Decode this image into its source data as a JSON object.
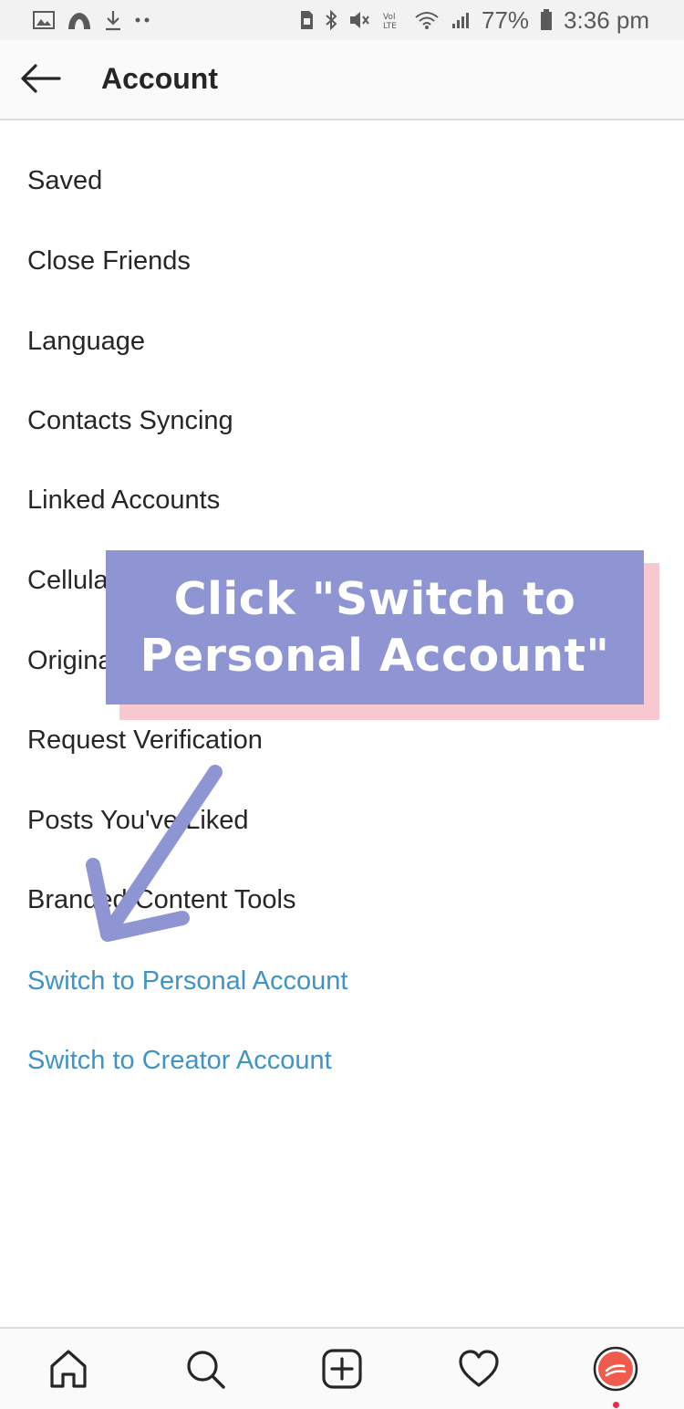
{
  "status_bar": {
    "battery": "77%",
    "time": "3:36 pm",
    "icons_left": [
      "image-icon",
      "cloud-icon",
      "download-icon",
      "more-dots-icon"
    ],
    "icons_right": [
      "sim-icon",
      "bluetooth-icon",
      "mute-icon",
      "volte-icon",
      "wifi-icon",
      "signal-icon",
      "battery-icon"
    ]
  },
  "header": {
    "title": "Account",
    "back_icon": "arrow-left-icon"
  },
  "menu": {
    "items": [
      {
        "label": "Saved"
      },
      {
        "label": "Close Friends"
      },
      {
        "label": "Language"
      },
      {
        "label": "Contacts Syncing"
      },
      {
        "label": "Linked Accounts"
      },
      {
        "label": "Cellular Data Use"
      },
      {
        "label": "Original Posts"
      },
      {
        "label": "Request Verification"
      },
      {
        "label": "Posts You've Liked"
      },
      {
        "label": "Branded Content Tools"
      }
    ],
    "links": [
      {
        "label": "Switch to Personal Account"
      },
      {
        "label": "Switch to Creator Account"
      }
    ]
  },
  "annotation": {
    "line1": "Click \"Switch to",
    "line2": "Personal Account\""
  },
  "bottom_nav": {
    "items": [
      "home-icon",
      "search-icon",
      "add-post-icon",
      "activity-heart-icon",
      "profile-avatar-icon"
    ]
  },
  "colors": {
    "link": "#3f94c7",
    "callout": "#8e95d2",
    "callout_shadow": "#f7c8d0",
    "arrow": "#8e95d2"
  }
}
